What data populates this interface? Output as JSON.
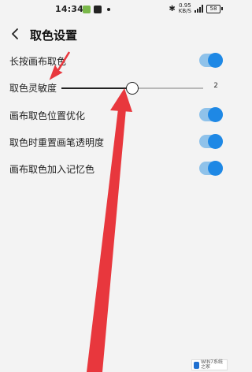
{
  "status_bar": {
    "time": "14:34",
    "net_speed": "0.95",
    "net_unit": "KB/S",
    "battery": "58"
  },
  "header": {
    "title": "取色设置"
  },
  "settings": [
    {
      "label": "长按画布取色",
      "enabled": true
    },
    {
      "label": "取色灵敏度",
      "slider_value": "2",
      "slider_fraction": 0.5
    },
    {
      "label": "画布取色位置优化",
      "enabled": true
    },
    {
      "label": "取色时重置画笔透明度",
      "enabled": true
    },
    {
      "label": "画布取色加入记忆色",
      "enabled": true
    }
  ],
  "watermark": {
    "text": "WIN7系统之家"
  },
  "colors": {
    "accent": "#1e88e5",
    "track_on": "#8fc2ea",
    "arrow": "#e8373d",
    "background": "#f3f3f3"
  },
  "icons": [
    "back-arrow-icon",
    "bluetooth-icon",
    "signal-icon",
    "battery-icon"
  ]
}
